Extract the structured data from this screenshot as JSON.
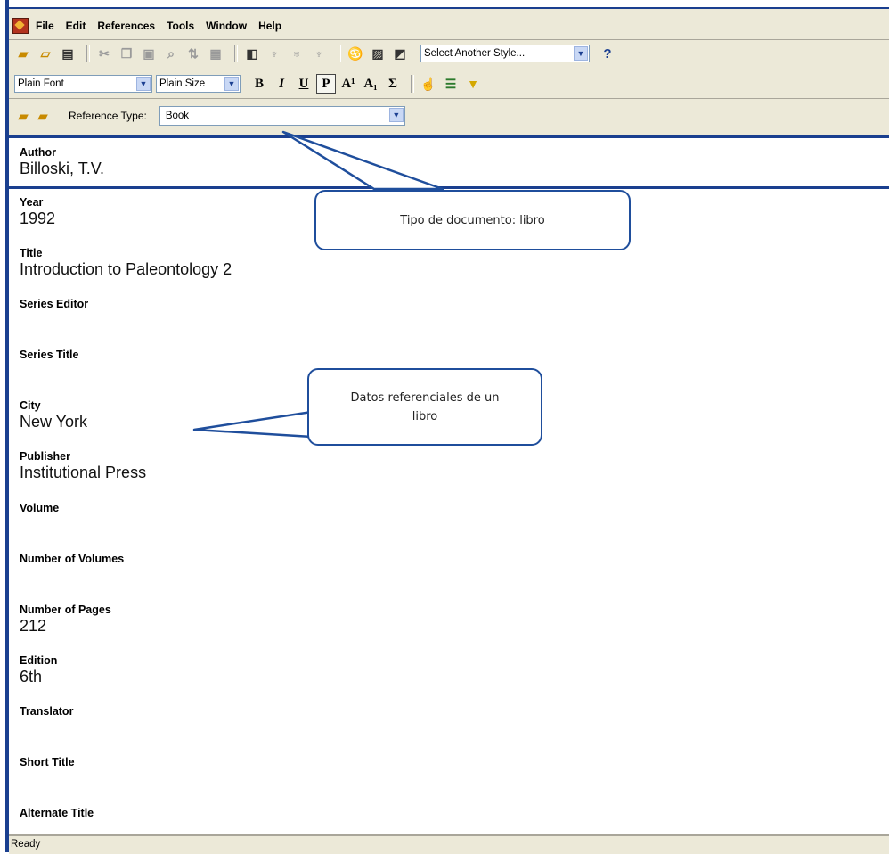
{
  "menu": [
    "File",
    "Edit",
    "References",
    "Tools",
    "Window",
    "Help"
  ],
  "toolbar": {
    "style_select": "Select Another Style...",
    "help_label": "?",
    "font_select": "Plain Font",
    "size_select": "Plain Size",
    "format_buttons": [
      "B",
      "I",
      "U",
      "P",
      "A¹",
      "A₁",
      "Σ"
    ],
    "reference_type_label": "Reference Type:",
    "reference_type_value": "Book"
  },
  "fields": [
    {
      "label": "Author",
      "value": "Billoski, T.V."
    },
    {
      "label": "Year",
      "value": "1992"
    },
    {
      "label": "Title",
      "value": "Introduction to Paleontology 2"
    },
    {
      "label": "Series Editor",
      "value": ""
    },
    {
      "label": "Series Title",
      "value": ""
    },
    {
      "label": "City",
      "value": "New York"
    },
    {
      "label": "Publisher",
      "value": "Institutional Press"
    },
    {
      "label": "Volume",
      "value": ""
    },
    {
      "label": "Number of Volumes",
      "value": ""
    },
    {
      "label": "Number of Pages",
      "value": "212"
    },
    {
      "label": "Edition",
      "value": "6th"
    },
    {
      "label": "Translator",
      "value": ""
    },
    {
      "label": "Short Title",
      "value": ""
    },
    {
      "label": "Alternate Title",
      "value": ""
    }
  ],
  "callouts": {
    "document_type": "Tipo de documento: libro",
    "reference_data_line1": "Datos referenciales de un",
    "reference_data_line2": "libro"
  },
  "status": "Ready",
  "colors": {
    "frame": "#1a3f8f",
    "chrome": "#ece9d8",
    "callout_border": "#1f4e9c"
  }
}
